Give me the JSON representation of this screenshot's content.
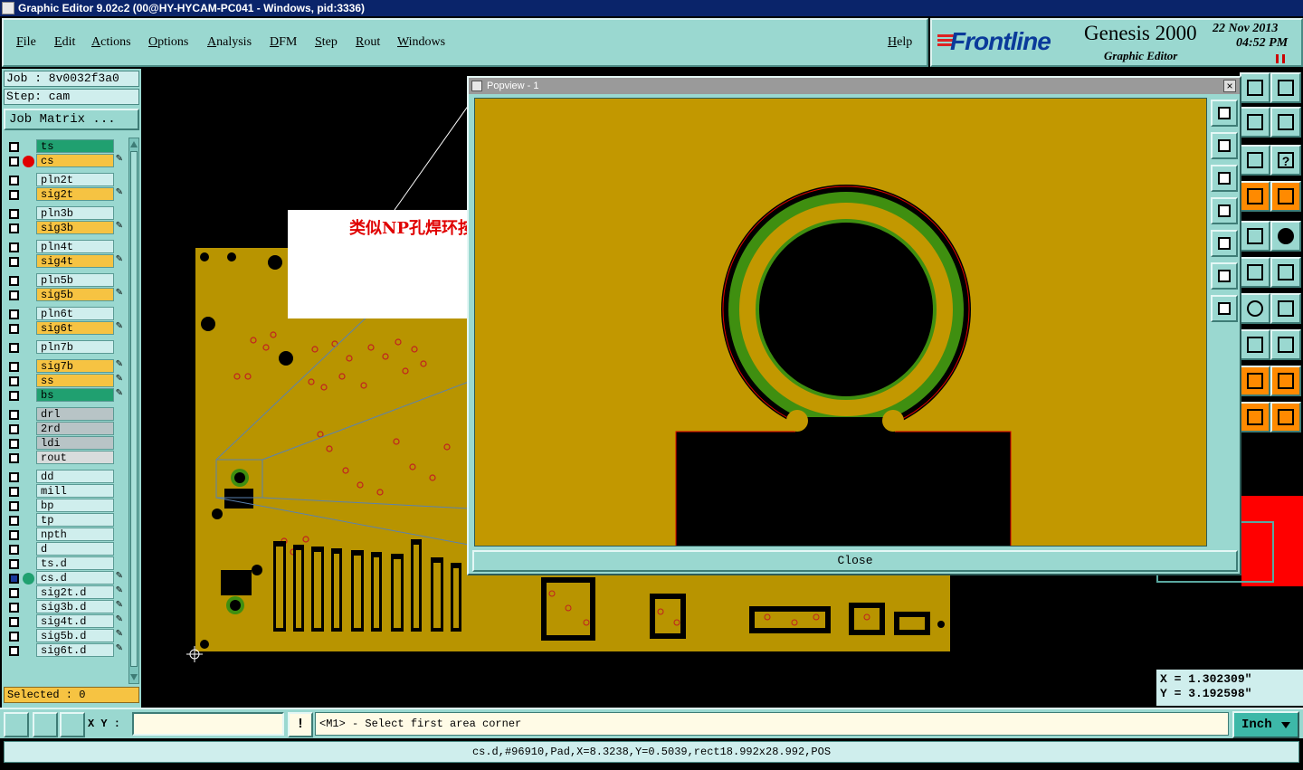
{
  "window": {
    "title": "Graphic Editor 9.02c2 (00@HY-HYCAM-PC041 - Windows, pid:3336)"
  },
  "menu": [
    {
      "label": "File"
    },
    {
      "label": "Edit"
    },
    {
      "label": "Actions"
    },
    {
      "label": "Options"
    },
    {
      "label": "Analysis"
    },
    {
      "label": "DFM"
    },
    {
      "label": "Step"
    },
    {
      "label": "Rout"
    },
    {
      "label": "Windows"
    },
    {
      "label": "Help"
    }
  ],
  "logo": {
    "brand": "Frontline",
    "product": "Genesis 2000",
    "subtitle": "Graphic Editor",
    "date": "22 Nov 2013",
    "time": "04:52 PM"
  },
  "job": {
    "job_label": "Job : 8v0032f3a0",
    "step_label": "Step: cam",
    "matrix_button": "Job Matrix ..."
  },
  "layers": [
    {
      "name": "ts",
      "color": "#20a070",
      "edit": false,
      "dot": ""
    },
    {
      "name": "cs",
      "color": "#f6c342",
      "edit": true,
      "dot": "#e00000"
    },
    {
      "name": "pln2t",
      "color": "#cfeeed",
      "edit": false,
      "dot": ""
    },
    {
      "name": "sig2t",
      "color": "#f6c342",
      "edit": true,
      "dot": ""
    },
    {
      "name": "pln3b",
      "color": "#cfeeed",
      "edit": false,
      "dot": ""
    },
    {
      "name": "sig3b",
      "color": "#f6c342",
      "edit": true,
      "dot": ""
    },
    {
      "name": "pln4t",
      "color": "#cfeeed",
      "edit": false,
      "dot": ""
    },
    {
      "name": "sig4t",
      "color": "#f6c342",
      "edit": true,
      "dot": ""
    },
    {
      "name": "pln5b",
      "color": "#cfeeed",
      "edit": false,
      "dot": ""
    },
    {
      "name": "sig5b",
      "color": "#f6c342",
      "edit": true,
      "dot": ""
    },
    {
      "name": "pln6t",
      "color": "#cfeeed",
      "edit": false,
      "dot": ""
    },
    {
      "name": "sig6t",
      "color": "#f6c342",
      "edit": true,
      "dot": ""
    },
    {
      "name": "pln7b",
      "color": "#cfeeed",
      "edit": false,
      "dot": ""
    },
    {
      "name": "sig7b",
      "color": "#f6c342",
      "edit": true,
      "dot": ""
    },
    {
      "name": "ss",
      "color": "#f6c342",
      "edit": true,
      "dot": ""
    },
    {
      "name": "bs",
      "color": "#20a070",
      "edit": true,
      "dot": ""
    },
    {
      "name": "drl",
      "color": "#b8c4c6",
      "edit": false,
      "dot": ""
    },
    {
      "name": "2rd",
      "color": "#b8c4c6",
      "edit": false,
      "dot": ""
    },
    {
      "name": "ldi",
      "color": "#b8c4c6",
      "edit": false,
      "dot": ""
    },
    {
      "name": "rout",
      "color": "#d8dcdc",
      "edit": false,
      "dot": ""
    },
    {
      "name": "dd",
      "color": "#cfeeed",
      "edit": false,
      "dot": ""
    },
    {
      "name": "mill",
      "color": "#cfeeed",
      "edit": false,
      "dot": ""
    },
    {
      "name": "bp",
      "color": "#cfeeed",
      "edit": false,
      "dot": ""
    },
    {
      "name": "tp",
      "color": "#cfeeed",
      "edit": false,
      "dot": ""
    },
    {
      "name": "npth",
      "color": "#cfeeed",
      "edit": false,
      "dot": ""
    },
    {
      "name": "d",
      "color": "#cfeeed",
      "edit": false,
      "dot": ""
    },
    {
      "name": "ts.d",
      "color": "#cfeeed",
      "edit": false,
      "dot": ""
    },
    {
      "name": "cs.d",
      "color": "#cfeeed",
      "edit": true,
      "dot": "#20a070"
    },
    {
      "name": "sig2t.d",
      "color": "#cfeeed",
      "edit": true,
      "dot": ""
    },
    {
      "name": "sig3b.d",
      "color": "#cfeeed",
      "edit": true,
      "dot": ""
    },
    {
      "name": "sig4t.d",
      "color": "#cfeeed",
      "edit": true,
      "dot": ""
    },
    {
      "name": "sig5b.d",
      "color": "#cfeeed",
      "edit": true,
      "dot": ""
    },
    {
      "name": "sig6t.d",
      "color": "#cfeeed",
      "edit": true,
      "dot": ""
    }
  ],
  "selected": "Selected : 0",
  "popview": {
    "title": "Popview - 1",
    "close_button": "Close"
  },
  "annotation": {
    "text": "类似NP孔焊环按文件"
  },
  "coords": {
    "x": "X = 1.302309\"",
    "y": "Y = 3.192598\""
  },
  "bottom": {
    "xy_label": "X Y :",
    "xy_value": "",
    "prompt": "<M1> - Select first area corner",
    "unit": "Inch"
  },
  "status": "cs.d,#96910,Pad,X=8.3238,Y=0.5039,rect18.992x28.992,POS",
  "colors": {
    "panel": "#9ad8d0",
    "board_copper": "#b89400",
    "popview_copper": "#c29800",
    "ring_green": "#3f8f10",
    "highlight_red": "#ff0000"
  }
}
